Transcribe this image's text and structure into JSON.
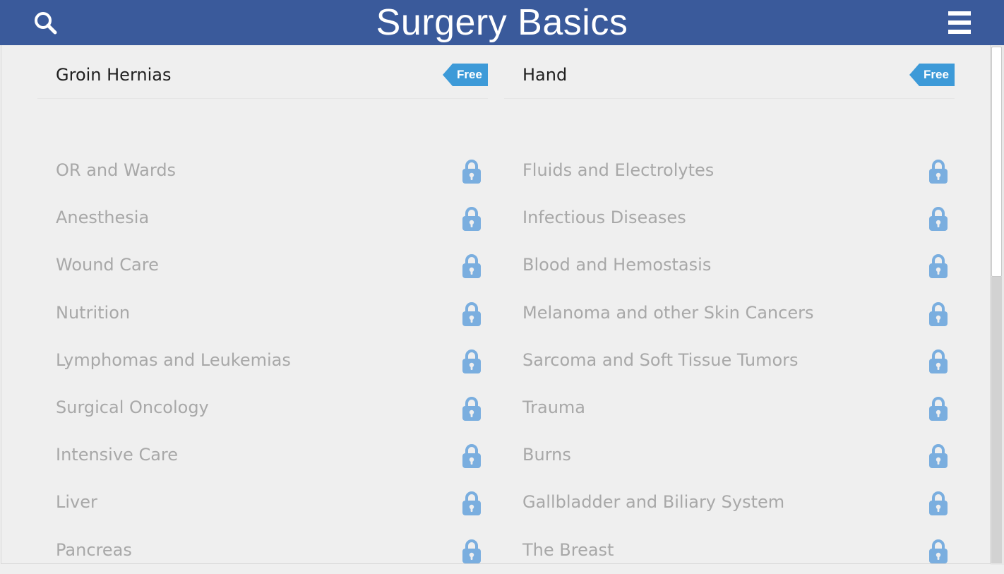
{
  "header": {
    "title": "Surgery Basics",
    "search_icon": "search-icon",
    "menu_icon": "hamburger-menu-icon",
    "background_color": "#3a5a9b"
  },
  "free_badge_label": "Free",
  "colors": {
    "badge": "#3d9ad8",
    "lock": "#7aaedf",
    "locked_text": "#a8a8a8",
    "free_text": "#1f1f1f"
  },
  "free_items": [
    {
      "label": "Groin Hernias"
    },
    {
      "label": "Hand"
    }
  ],
  "locked_items": {
    "left": [
      {
        "label": "OR and Wards"
      },
      {
        "label": "Anesthesia"
      },
      {
        "label": "Wound Care"
      },
      {
        "label": "Nutrition"
      },
      {
        "label": "Lymphomas and Leukemias"
      },
      {
        "label": "Surgical Oncology"
      },
      {
        "label": "Intensive Care"
      },
      {
        "label": "Liver"
      },
      {
        "label": "Pancreas"
      }
    ],
    "right": [
      {
        "label": "Fluids and Electrolytes"
      },
      {
        "label": "Infectious Diseases"
      },
      {
        "label": "Blood and Hemostasis"
      },
      {
        "label": "Melanoma and other Skin Cancers"
      },
      {
        "label": "Sarcoma and Soft Tissue Tumors"
      },
      {
        "label": "Trauma"
      },
      {
        "label": "Burns"
      },
      {
        "label": "Gallbladder and Biliary System"
      },
      {
        "label": "The Breast"
      }
    ]
  }
}
